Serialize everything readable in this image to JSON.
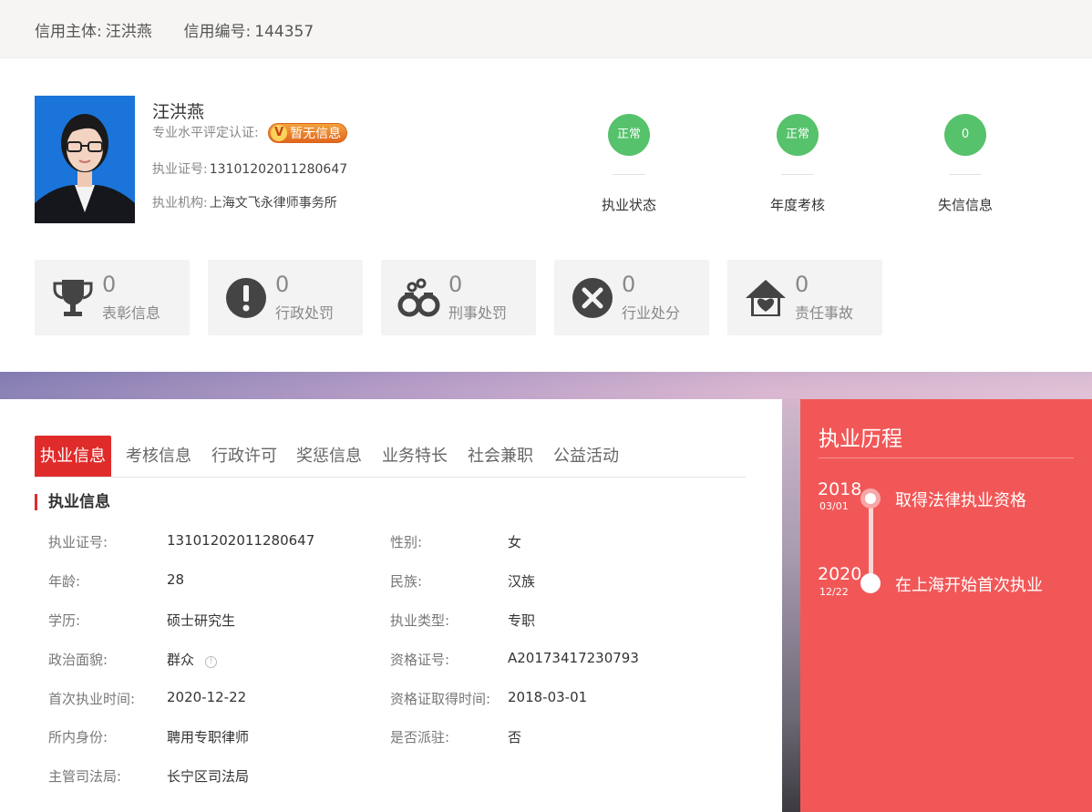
{
  "header": {
    "subject_label": "信用主体:",
    "subject_value": "汪洪燕",
    "code_label": "信用编号:",
    "code_value": "144357"
  },
  "profile": {
    "name": "汪洪燕",
    "cert_label": "专业水平评定认证:",
    "cert_badge": "暂无信息",
    "license_label": "执业证号:",
    "license_value": "13101202011280647",
    "org_label": "执业机构:",
    "org_value": "上海文飞永律师事务所"
  },
  "statuses": [
    {
      "value": "正常",
      "label": "执业状态"
    },
    {
      "value": "正常",
      "label": "年度考核"
    },
    {
      "value": "0",
      "label": "失信信息"
    }
  ],
  "stat_cards": [
    {
      "count": "0",
      "label": "表彰信息",
      "icon": "trophy-icon"
    },
    {
      "count": "0",
      "label": "行政处罚",
      "icon": "exclamation-icon"
    },
    {
      "count": "0",
      "label": "刑事处罚",
      "icon": "handcuffs-icon"
    },
    {
      "count": "0",
      "label": "行业处分",
      "icon": "x-circle-icon"
    },
    {
      "count": "0",
      "label": "责任事故",
      "icon": "house-heart-icon"
    }
  ],
  "tabs": [
    "执业信息",
    "考核信息",
    "行政许可",
    "奖惩信息",
    "业务特长",
    "社会兼职",
    "公益活动"
  ],
  "section_title": "执业信息",
  "fields_left": [
    {
      "k": "执业证号:",
      "v": "13101202011280647"
    },
    {
      "k": "年龄:",
      "v": "28"
    },
    {
      "k": "学历:",
      "v": "硕士研究生"
    },
    {
      "k": "政治面貌:",
      "v": "群众"
    },
    {
      "k": "首次执业时间:",
      "v": "2020-12-22"
    },
    {
      "k": "所内身份:",
      "v": "聘用专职律师"
    },
    {
      "k": "主管司法局:",
      "v": "长宁区司法局"
    }
  ],
  "fields_right": [
    {
      "k": "性别:",
      "v": "女"
    },
    {
      "k": "民族:",
      "v": "汉族"
    },
    {
      "k": "执业类型:",
      "v": "专职"
    },
    {
      "k": "资格证号:",
      "v": "A20173417230793"
    },
    {
      "k": "资格证取得时间:",
      "v": "2018-03-01"
    },
    {
      "k": "是否派驻:",
      "v": "否"
    }
  ],
  "timeline": {
    "title": "执业历程",
    "events": [
      {
        "year": "2018",
        "date": "03/01",
        "text": "取得法律执业资格"
      },
      {
        "year": "2020",
        "date": "12/22",
        "text": "在上海开始首次执业"
      }
    ]
  },
  "colors": {
    "accent": "#e02b2b",
    "status_green": "#56c26b",
    "side_bg": "#f25757"
  }
}
